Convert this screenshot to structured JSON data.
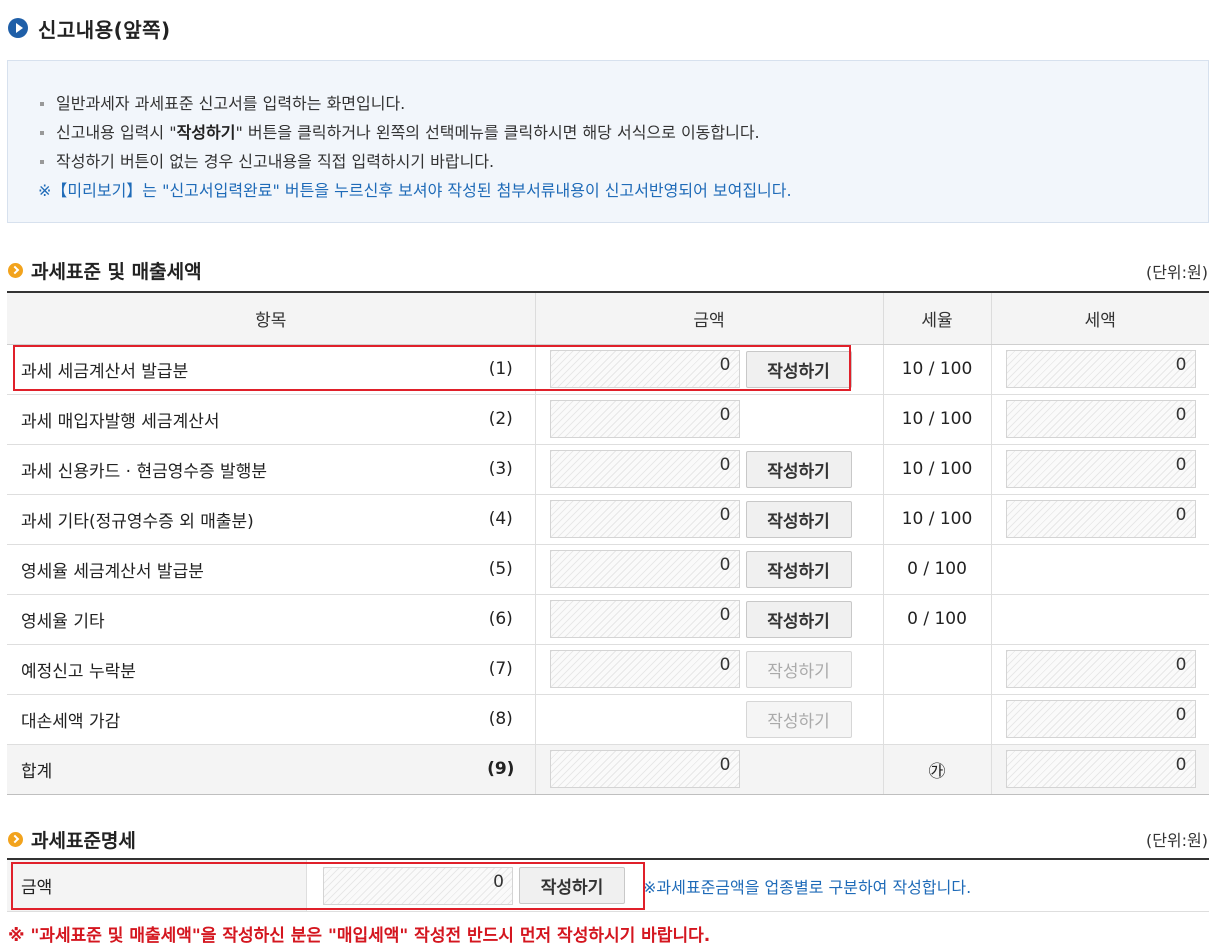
{
  "page": {
    "title": "신고내용(앞쪽)"
  },
  "info": {
    "line1": "일반과세자 과세표준 신고서를 입력하는 화면입니다.",
    "line2_pre": "신고내용 입력시 \"",
    "line2_bold": "작성하기",
    "line2_post": "\" 버튼을 클릭하거나 왼쪽의 선택메뉴를 클릭하시면 해당 서식으로 이동합니다.",
    "line3": "작성하기 버튼이 없는 경우 신고내용을 직접 입력하시기 바랍니다.",
    "line4": "※【미리보기】는 \"신고서입력완료\" 버튼을 누르신후 보셔야 작성된 첨부서류내용이 신고서반영되어 보여집니다."
  },
  "section1": {
    "title": "과세표준 및 매출세액",
    "unit": "(단위:원)",
    "headers": {
      "item": "항목",
      "amount": "금액",
      "rate": "세율",
      "tax": "세액"
    },
    "button_label": "작성하기",
    "rows": [
      {
        "label": "과세 세금계산서 발급분",
        "num": "(1)",
        "amount": "0",
        "rate": "10 / 100",
        "tax": "0"
      },
      {
        "label": "과세 매입자발행 세금계산서",
        "num": "(2)",
        "amount": "0",
        "rate": "10 / 100",
        "tax": "0"
      },
      {
        "label": "과세 신용카드 · 현금영수증 발행분",
        "num": "(3)",
        "amount": "0",
        "rate": "10 / 100",
        "tax": "0"
      },
      {
        "label": "과세 기타(정규영수증 외 매출분)",
        "num": "(4)",
        "amount": "0",
        "rate": "10 / 100",
        "tax": "0"
      },
      {
        "label": "영세율 세금계산서 발급분",
        "num": "(5)",
        "amount": "0",
        "rate": "0 / 100"
      },
      {
        "label": "영세율 기타",
        "num": "(6)",
        "amount": "0",
        "rate": "0 / 100"
      },
      {
        "label": "예정신고 누락분",
        "num": "(7)",
        "amount": "0",
        "tax": "0"
      },
      {
        "label": "대손세액 가감",
        "num": "(8)",
        "tax": "0"
      },
      {
        "label": "합계",
        "num": "(9)",
        "amount": "0",
        "rate": "㉮",
        "tax": "0"
      }
    ]
  },
  "section2": {
    "title": "과세표준명세",
    "unit": "(단위:원)",
    "label": "금액",
    "amount": "0",
    "button_label": "작성하기",
    "note": "※과세표준금액을 업종별로 구분하여 작성합니다."
  },
  "warning": "※ \"과세표준 및 매출세액\"을 작성하신 분은 \"매입세액\" 작성전 반드시 먼저 작성하시기 바랍니다.",
  "colors": {
    "accent_blue": "#1f5fa8",
    "note_blue": "#1f6bb8",
    "bullet_orange": "#f2a31d",
    "highlight_red": "#e0202a",
    "warning_red": "#d4161f"
  }
}
